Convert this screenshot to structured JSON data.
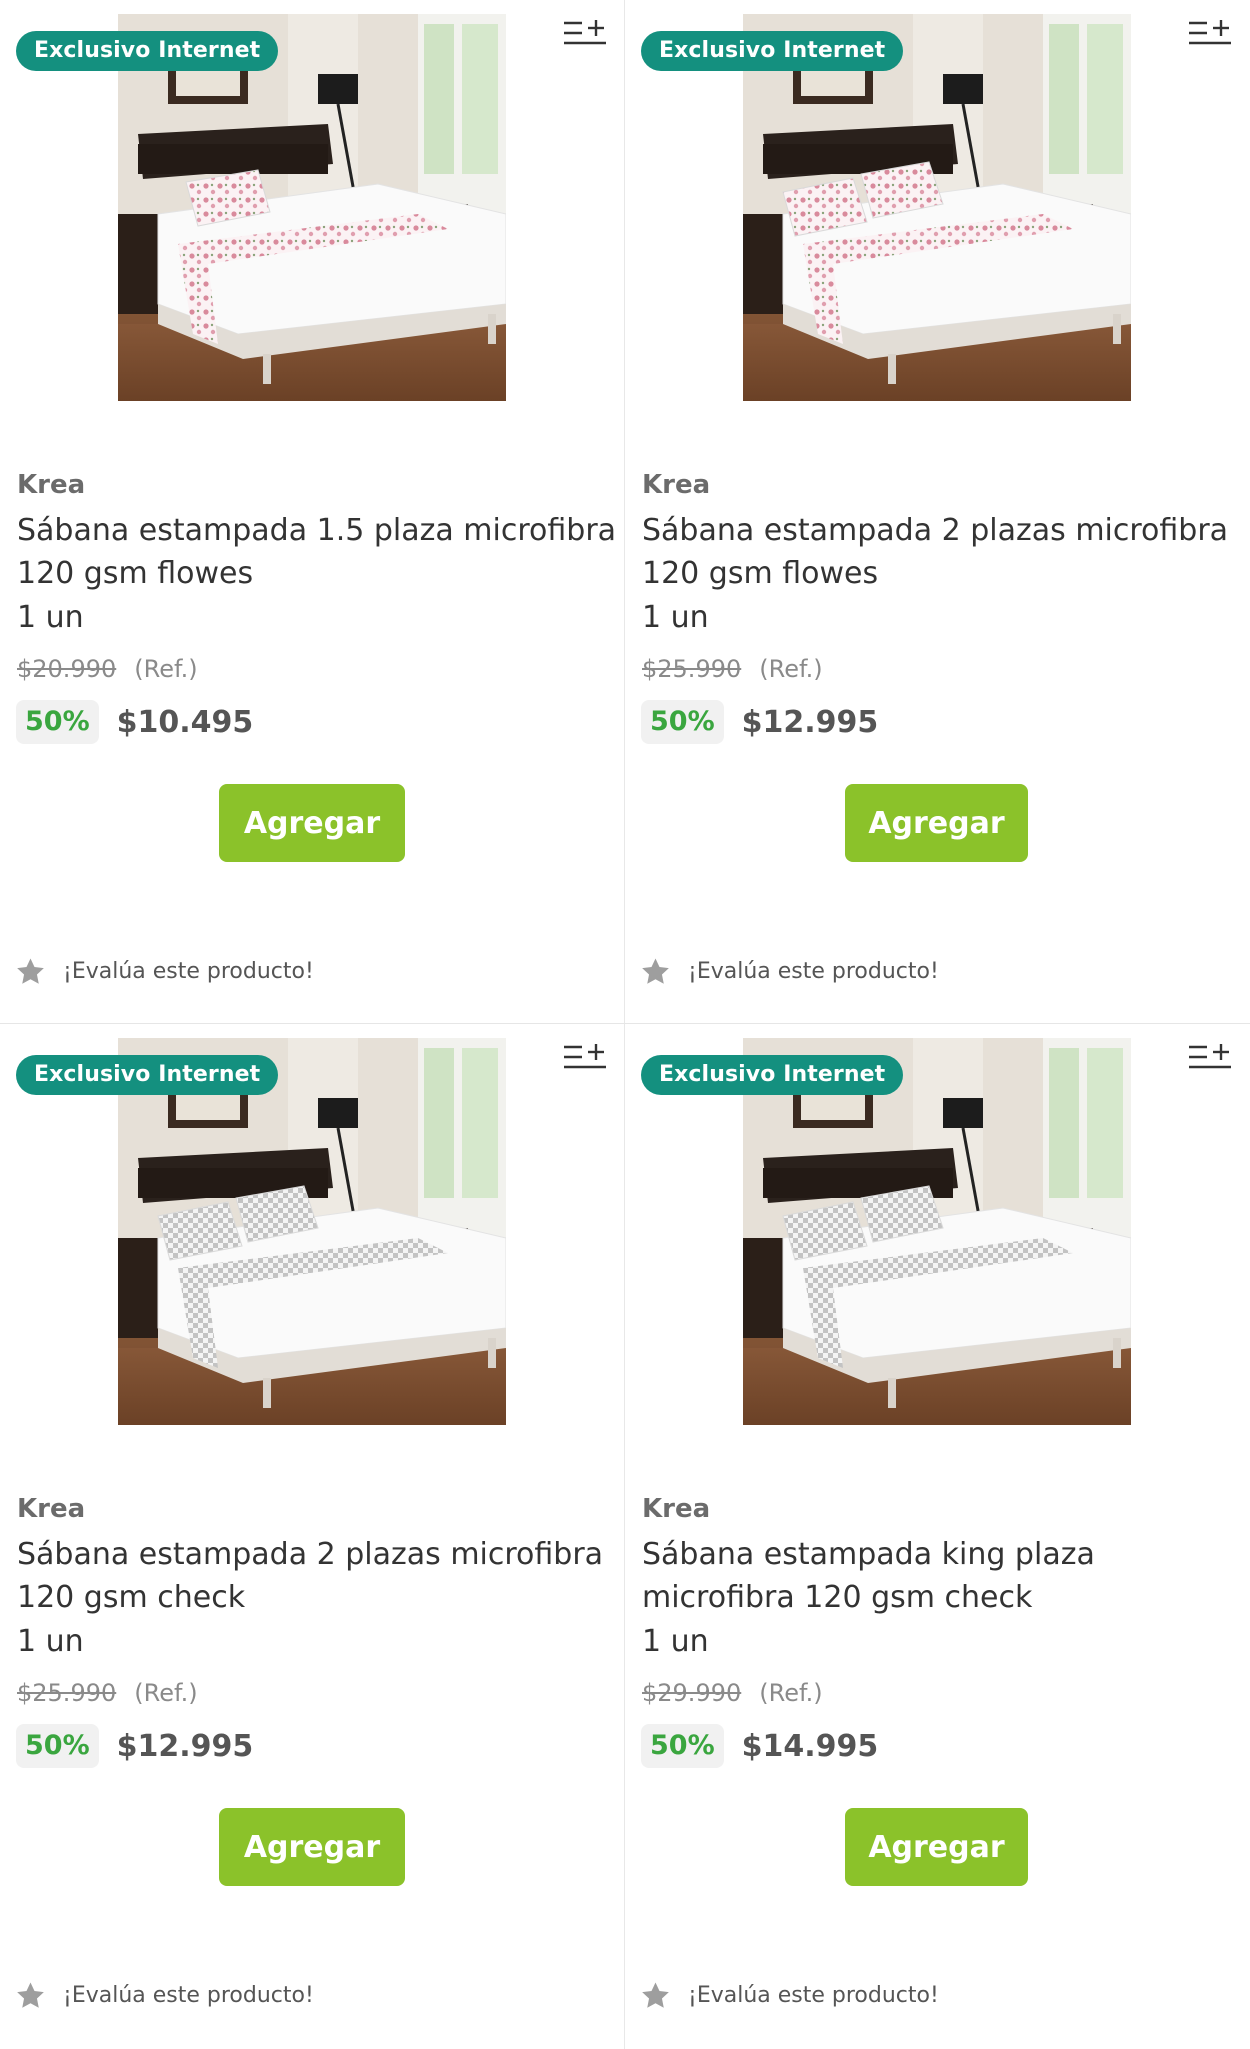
{
  "products": [
    {
      "badge": "Exclusivo Internet",
      "compare_icon": "compare-add-icon",
      "brand": "Krea",
      "title": "Sábana estampada 1.5 plaza microfibra 120 gsm flowes",
      "unit": "1 un",
      "old_price": "$20.990",
      "ref_label": "(Ref.)",
      "discount": "50%",
      "price": "$10.495",
      "add_label": "Agregar",
      "rate_label": "¡Evalúa este producto!",
      "image": {
        "pattern": "floral",
        "pillows": 1,
        "pattern_color": "#d98a9c"
      }
    },
    {
      "badge": "Exclusivo Internet",
      "compare_icon": "compare-add-icon",
      "brand": "Krea",
      "title": "Sábana estampada 2 plazas microfibra 120 gsm flowes",
      "unit": "1 un",
      "old_price": "$25.990",
      "ref_label": "(Ref.)",
      "discount": "50%",
      "price": "$12.995",
      "add_label": "Agregar",
      "rate_label": "¡Evalúa este producto!",
      "image": {
        "pattern": "floral",
        "pillows": 2,
        "pattern_color": "#d98a9c"
      }
    },
    {
      "badge": "Exclusivo Internet",
      "compare_icon": "compare-add-icon",
      "brand": "Krea",
      "title": "Sábana estampada 2 plazas microfibra 120 gsm check",
      "unit": "1 un",
      "old_price": "$25.990",
      "ref_label": "(Ref.)",
      "discount": "50%",
      "price": "$12.995",
      "add_label": "Agregar",
      "rate_label": "¡Evalúa este producto!",
      "image": {
        "pattern": "check",
        "pillows": 2,
        "pattern_color": "#9a9a9a"
      }
    },
    {
      "badge": "Exclusivo Internet",
      "compare_icon": "compare-add-icon",
      "brand": "Krea",
      "title": "Sábana estampada king plaza microfibra 120 gsm check",
      "unit": "1 un",
      "old_price": "$29.990",
      "ref_label": "(Ref.)",
      "discount": "50%",
      "price": "$14.995",
      "add_label": "Agregar",
      "rate_label": "¡Evalúa este producto!",
      "image": {
        "pattern": "check",
        "pillows": 2,
        "pattern_color": "#9a9a9a"
      }
    }
  ],
  "colors": {
    "badge": "#14907f",
    "add_button": "#8bc22a",
    "discount_text": "#3aa63f",
    "star": "#9e9e9e"
  }
}
